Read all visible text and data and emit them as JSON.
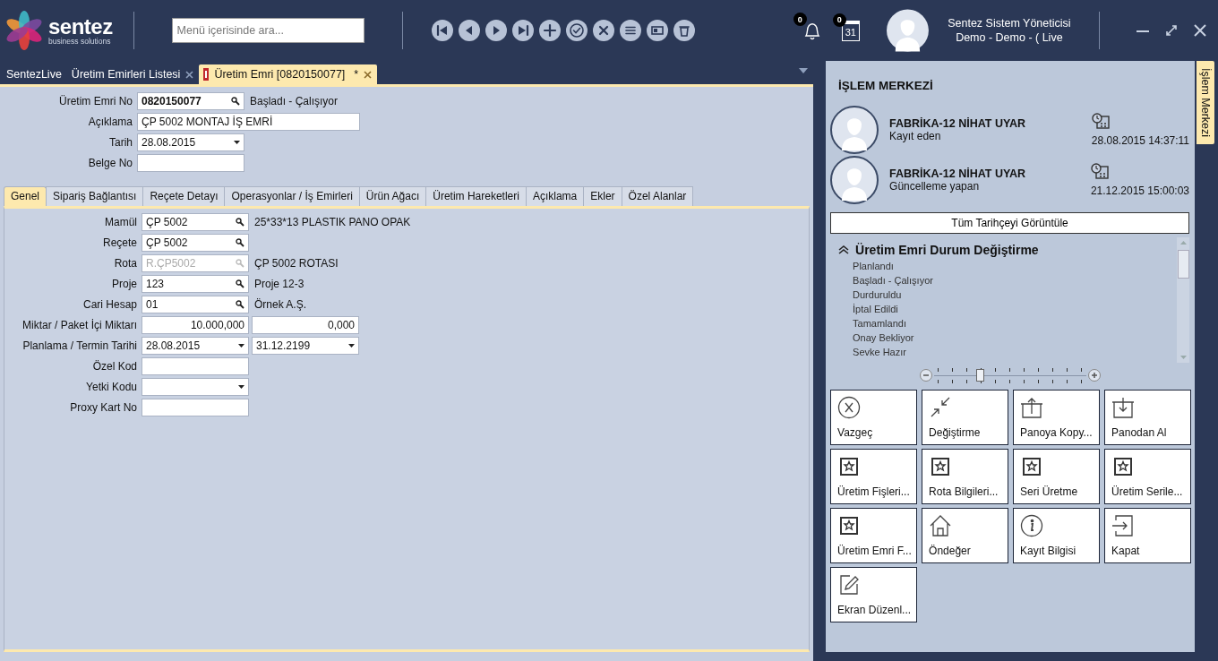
{
  "header": {
    "logo_name": "sentez",
    "logo_tagline": "business solutions",
    "search": {
      "placeholder": "Menü içerisinde ara..."
    },
    "notifications": {
      "count": "0"
    },
    "calendar": {
      "count": "0",
      "day": "31"
    },
    "user": {
      "name": "Sentez Sistem Yöneticisi",
      "company": "Demo - Demo - ( Live"
    }
  },
  "doc_tabs": [
    {
      "label": "SentezLive",
      "selected": false,
      "closable": false
    },
    {
      "label": "Üretim Emirleri Listesi",
      "selected": false,
      "closable": true
    },
    {
      "label": "Üretim Emri [0820150077]",
      "selected": true,
      "closable": true,
      "modified": "*"
    }
  ],
  "header_fields": [
    {
      "label": "Üretim Emri No",
      "kind": "lookup",
      "value": "0820150077",
      "bold": true,
      "note": "Başladı - Çalışıyor"
    },
    {
      "label": "Açıklama",
      "kind": "wide",
      "value": "ÇP 5002 MONTAJ İŞ EMRİ"
    },
    {
      "label": "Tarih",
      "kind": "date",
      "value": "28.08.2015"
    },
    {
      "label": "Belge No",
      "kind": "text"
    }
  ],
  "form_tabs": [
    {
      "label": "Genel",
      "selected": true
    },
    {
      "label": "Sipariş Bağlantısı",
      "selected": false
    },
    {
      "label": "Reçete Detayı",
      "selected": false
    },
    {
      "label": "Operasyonlar / İş Emirleri",
      "selected": false
    },
    {
      "label": "Ürün Ağacı",
      "selected": false
    },
    {
      "label": "Üretim Hareketleri",
      "selected": false
    },
    {
      "label": "Açıklama",
      "selected": false
    },
    {
      "label": "Ekler",
      "selected": false
    },
    {
      "label": "Özel Alanlar",
      "selected": false
    }
  ],
  "general_fields": [
    {
      "label": "Mamül",
      "kind": "lookup",
      "value": "ÇP 5002",
      "note": "25*33*13 PLASTIK PANO OPAK"
    },
    {
      "label": "Reçete",
      "kind": "lookup",
      "value": "ÇP 5002"
    },
    {
      "label": "Rota",
      "kind": "lookup",
      "value": "R.ÇP5002",
      "disabled": true,
      "note": "ÇP 5002 ROTASI"
    },
    {
      "label": "Proje",
      "kind": "lookup",
      "value": "123",
      "note": "Proje 12-3"
    },
    {
      "label": "Cari Hesap",
      "kind": "lookup",
      "value": "01",
      "note": "Örnek A.Ş."
    },
    {
      "label": "Miktar / Paket İçi Miktarı",
      "kind": "number",
      "value": "10.000,000",
      "second": {
        "kind": "number",
        "value": "0,000"
      }
    },
    {
      "label": "Planlama / Termin Tarihi",
      "kind": "date",
      "value": "28.08.2015",
      "second": {
        "kind": "date",
        "value": "31.12.2199"
      }
    },
    {
      "label": "Özel Kod",
      "kind": "text"
    },
    {
      "label": "Yetki Kodu",
      "kind": "date"
    },
    {
      "label": "Proxy Kart No",
      "kind": "text"
    }
  ],
  "side_panel": {
    "title": "İŞLEM MERKEZİ",
    "tab_label": "İşlem Merkezi",
    "history": [
      {
        "name": "FABRİKA-12 NİHAT UYAR",
        "role": "Kayıt eden",
        "datetime": "28.08.2015 14:37:11"
      },
      {
        "name": "FABRİKA-12 NİHAT UYAR",
        "role": "Güncelleme yapan",
        "datetime": "21.12.2015 15:00:03"
      }
    ],
    "history_button": "Tüm Tarihçeyi Görüntüle",
    "status_section": {
      "title": "Üretim Emri Durum Değiştirme",
      "expanded": true,
      "items": [
        "Planlandı",
        "Başladı - Çalışıyor",
        "Durduruldu",
        "İptal Edildi",
        "Tamamlandı",
        "Onay Bekliyor",
        "Sevke Hazır"
      ]
    },
    "zoom": {
      "level": 0.3
    },
    "actions": [
      {
        "label": "Vazgeç",
        "kind": "cancel"
      },
      {
        "label": "Değiştirme",
        "kind": "shrink"
      },
      {
        "label": "Panoya Kopy...",
        "kind": "box-up"
      },
      {
        "label": "Panodan Al",
        "kind": "box-down"
      },
      {
        "label": "Üretim Fişleri...",
        "kind": "star"
      },
      {
        "label": "Rota Bilgileri...",
        "kind": "star"
      },
      {
        "label": "Seri Üretme",
        "kind": "star"
      },
      {
        "label": "Üretim Serile...",
        "kind": "star"
      },
      {
        "label": "Üretim Emri F...",
        "kind": "star"
      },
      {
        "label": "Öndeğer",
        "kind": "home"
      },
      {
        "label": "Kayıt Bilgisi",
        "kind": "info"
      },
      {
        "label": "Kapat",
        "kind": "exit"
      },
      {
        "label": "Ekran Düzenl...",
        "kind": "edit"
      }
    ]
  }
}
